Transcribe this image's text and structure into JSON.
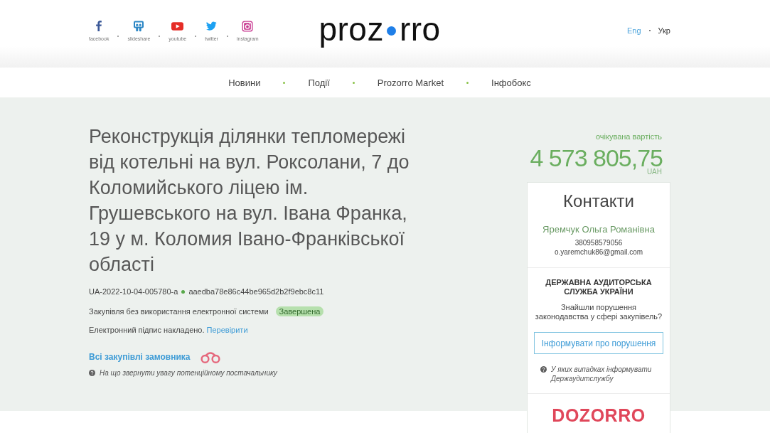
{
  "header": {
    "social_links": [
      {
        "kind": "facebook",
        "label": "facebook"
      },
      {
        "kind": "slideshare",
        "label": "slideshare"
      },
      {
        "kind": "youtube",
        "label": "youtube"
      },
      {
        "kind": "twitter",
        "label": "twitter"
      },
      {
        "kind": "instagram",
        "label": "instagram"
      }
    ],
    "logo": {
      "before_dot": "proz",
      "after_dot": "rro"
    },
    "languages": [
      {
        "label": "Eng",
        "selected": false
      },
      {
        "label": "Укр",
        "selected": true
      }
    ]
  },
  "nav": {
    "items": [
      {
        "label": "Новини"
      },
      {
        "label": "Події"
      },
      {
        "label": "Prozorro Market"
      },
      {
        "label": "Інфобокс"
      }
    ]
  },
  "tender": {
    "title": "Реконструкція ділянки тепломережі від котельні на вул. Роксолани, 7 до Коломийського ліцею ім. Грушевського на вул. Івана Франка, 19 у м. Коломия Івано-Франківської області",
    "tender_id": "UA-2022-10-04-005780-a",
    "hash": "aaedba78e86c44be965d2b2f9ebc8c11",
    "procedure": "Закупівля без використання електронної системи",
    "status": {
      "label": "Завершена",
      "kind": "complete"
    },
    "signature": {
      "text": "Електронний підпис накладено.",
      "link": "Перевірити"
    },
    "customer_link": "Всі закупівлі замовника",
    "hint": "На що звернути увагу потенційному постачальнику"
  },
  "value": {
    "label": "очікувана вартість",
    "amount": "4 573 805,75",
    "currency": "UAH"
  },
  "contacts": {
    "title": "Контакти",
    "name": "Яремчук Ольга Романівна",
    "phone": "380958579056",
    "email": "o.yaremchuk86@gmail.com"
  },
  "audit": {
    "title": "ДЕРЖАВНА АУДИТОРСЬКА СЛУЖБА УКРАЇНИ",
    "question": "Знайшли порушення законодавства у сфері закупівель?",
    "button": "Інформувати про порушення",
    "hint": "У яких випадках інформувати Держаудитслужбу"
  },
  "dozorro": {
    "logo": "DOZORRO"
  }
}
